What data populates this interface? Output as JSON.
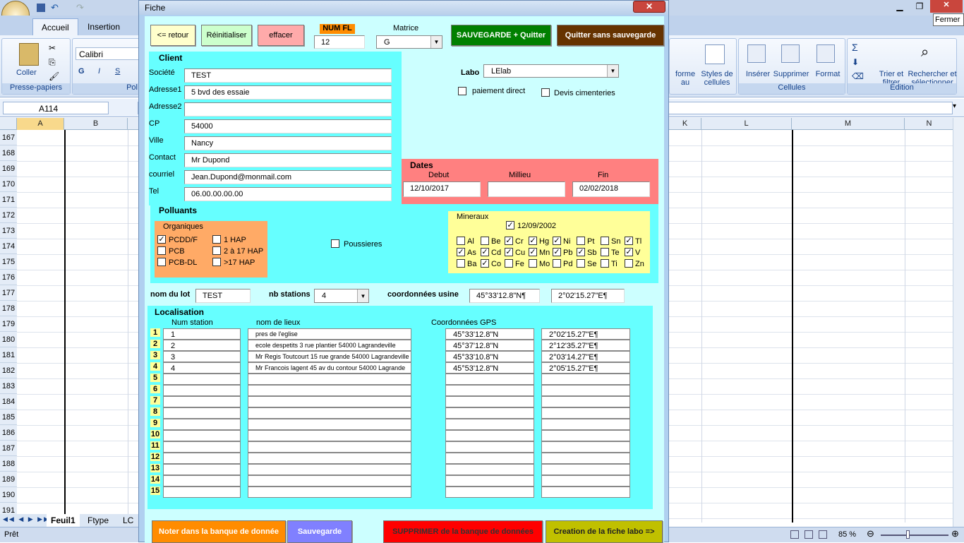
{
  "excel": {
    "tabs": [
      "Accueil",
      "Insertion"
    ],
    "ribbon": {
      "paste_label": "Coller",
      "clipboard_group": "Presse-papiers",
      "font_name": "Calibri",
      "font_group_partial": "Pol",
      "styles_partial_1": "forme",
      "styles_partial_2": "au",
      "cell_styles": "Styles de cellules",
      "insert": "Insérer",
      "delete": "Supprimer",
      "format": "Format",
      "cells_group": "Cellules",
      "sort": "Trier et filtrer",
      "find": "Rechercher et sélectionner",
      "edit_group": "Édition"
    },
    "tooltip": "Fermer",
    "name_box": "A114",
    "columns_left": [
      "A",
      "B"
    ],
    "columns_right": [
      "K",
      "L",
      "M",
      "N"
    ],
    "rows": [
      "167",
      "168",
      "169",
      "170",
      "171",
      "172",
      "173",
      "174",
      "175",
      "176",
      "177",
      "178",
      "179",
      "180",
      "181",
      "182",
      "183",
      "184",
      "185",
      "186",
      "187",
      "188",
      "189",
      "190",
      "191"
    ],
    "sheet_tabs": [
      "Feuil1",
      "Ftype",
      "LC"
    ],
    "status": "Prêt",
    "zoom": "85 %"
  },
  "form": {
    "title": "Fiche",
    "close_icon": "close-icon",
    "buttons": {
      "back": "<= retour",
      "reset": "Réinitialiser",
      "clear": "effacer",
      "save_quit": "SAUVEGARDE + Quitter",
      "quit_nosave": "Quitter sans sauvegarde",
      "db_note": "Noter dans la banque de donnée",
      "save": "Sauvegarde",
      "db_delete": "SUPPRIMER de la banque de données",
      "lab_sheet": "Creation de la fiche labo =>"
    },
    "num_fl_label": "NUM FL",
    "num_fl": "12",
    "matrice_label": "Matrice",
    "matrice": "G",
    "client": {
      "title": "Client",
      "fields": [
        {
          "label": "Société",
          "value": "TEST"
        },
        {
          "label": "Adresse1",
          "value": "5 bvd des essaie"
        },
        {
          "label": "Adresse2",
          "value": ""
        },
        {
          "label": "CP",
          "value": "54000"
        },
        {
          "label": "Ville",
          "value": "Nancy"
        },
        {
          "label": "Contact",
          "value": "Mr Dupond"
        },
        {
          "label": "courriel",
          "value": "Jean.Dupond@monmail.com"
        },
        {
          "label": "Tel",
          "value": "06.00.00.00.00"
        }
      ]
    },
    "labo_label": "Labo",
    "labo": "LElab",
    "paiement": "paiement direct",
    "devis": "Devis cimenteries",
    "dates": {
      "title": "Dates",
      "debut_label": "Debut",
      "debut": "12/10/2017",
      "milieu_label": "Millieu",
      "milieu": "",
      "fin_label": "Fin",
      "fin": "02/02/2018"
    },
    "polluants_title": "Polluants",
    "organiques": {
      "title": "Organiques",
      "items": [
        {
          "label": "PCDD/F",
          "checked": true
        },
        {
          "label": "PCB",
          "checked": false
        },
        {
          "label": "PCB-DL",
          "checked": false
        },
        {
          "label": "1 HAP",
          "checked": false
        },
        {
          "label": "2 à 17 HAP",
          "checked": false
        },
        {
          "label": ">17 HAP",
          "checked": false
        }
      ]
    },
    "poussieres": "Poussieres",
    "mineraux": {
      "title": "Mineraux",
      "date": "12/09/2002",
      "date_checked": true,
      "rows": [
        [
          {
            "l": "Al",
            "c": false
          },
          {
            "l": "Be",
            "c": false
          },
          {
            "l": "Cr",
            "c": true
          },
          {
            "l": "Hg",
            "c": true
          },
          {
            "l": "Ni",
            "c": true
          },
          {
            "l": "Pt",
            "c": false
          },
          {
            "l": "Sn",
            "c": false
          },
          {
            "l": "Tl",
            "c": true
          }
        ],
        [
          {
            "l": "As",
            "c": true
          },
          {
            "l": "Cd",
            "c": true
          },
          {
            "l": "Cu",
            "c": true
          },
          {
            "l": "Mn",
            "c": true
          },
          {
            "l": "Pb",
            "c": true
          },
          {
            "l": "Sb",
            "c": true
          },
          {
            "l": "Te",
            "c": false
          },
          {
            "l": "V",
            "c": true
          }
        ],
        [
          {
            "l": "Ba",
            "c": false
          },
          {
            "l": "Co",
            "c": true
          },
          {
            "l": "Fe",
            "c": false
          },
          {
            "l": "Mo",
            "c": false
          },
          {
            "l": "Pd",
            "c": false
          },
          {
            "l": "Se",
            "c": false
          },
          {
            "l": "Ti",
            "c": false
          },
          {
            "l": "Zn",
            "c": false
          }
        ]
      ]
    },
    "lot_label": "nom du lot",
    "lot": "TEST",
    "nb_stations_label": "nb stations",
    "nb_stations": "4",
    "coord_usine_label": "coordonnées usine",
    "coord_usine_n": "45°33'12.8\"N¶",
    "coord_usine_e": "2°02'15.27\"E¶",
    "localisation": {
      "title": "Localisation",
      "col_num": "Num station",
      "col_lieux": "nom de lieux",
      "col_gps": "Coordonnées GPS",
      "rows": [
        {
          "n": "1",
          "num": "1",
          "lieu": "pres de l'eglise",
          "lat": "45°33'12.8\"N",
          "lon": "2°02'15.27\"E¶"
        },
        {
          "n": "2",
          "num": "2",
          "lieu": "ecole despetits  3 rue plantier 54000 Lagrandeville",
          "lat": "45°37'12.8\"N",
          "lon": "2°12'35.27\"E¶"
        },
        {
          "n": "3",
          "num": "3",
          "lieu": "Mr Regis Toutcourt 15 rue grande 54000 Lagrandeville",
          "lat": "45°33'10.8\"N",
          "lon": "2°03'14.27\"E¶"
        },
        {
          "n": "4",
          "num": "4",
          "lieu": "Mr Francois lagent 45 av du contour 54000 Lagrande",
          "lat": "45°53'12.8\"N",
          "lon": "2°05'15.27\"E¶"
        },
        {
          "n": "5",
          "num": "",
          "lieu": "",
          "lat": "",
          "lon": ""
        },
        {
          "n": "6",
          "num": "",
          "lieu": "",
          "lat": "",
          "lon": ""
        },
        {
          "n": "7",
          "num": "",
          "lieu": "",
          "lat": "",
          "lon": ""
        },
        {
          "n": "8",
          "num": "",
          "lieu": "",
          "lat": "",
          "lon": ""
        },
        {
          "n": "9",
          "num": "",
          "lieu": "",
          "lat": "",
          "lon": ""
        },
        {
          "n": "10",
          "num": "",
          "lieu": "",
          "lat": "",
          "lon": ""
        },
        {
          "n": "11",
          "num": "",
          "lieu": "",
          "lat": "",
          "lon": ""
        },
        {
          "n": "12",
          "num": "",
          "lieu": "",
          "lat": "",
          "lon": ""
        },
        {
          "n": "13",
          "num": "",
          "lieu": "",
          "lat": "",
          "lon": ""
        },
        {
          "n": "14",
          "num": "",
          "lieu": "",
          "lat": "",
          "lon": ""
        },
        {
          "n": "15",
          "num": "",
          "lieu": "",
          "lat": "",
          "lon": ""
        }
      ]
    }
  }
}
